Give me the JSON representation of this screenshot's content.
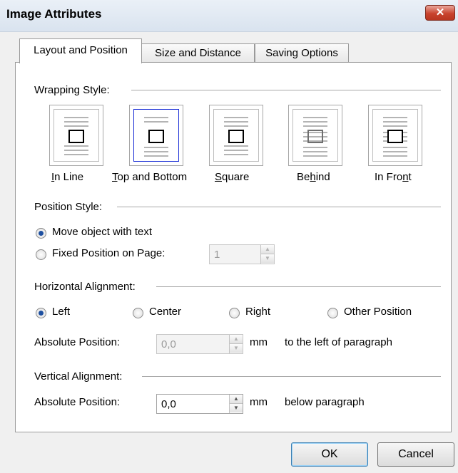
{
  "window": {
    "title": "Image Attributes",
    "close_glyph": "✕"
  },
  "tabs": [
    {
      "label": "Layout and Position",
      "active": true
    },
    {
      "label": "Size and Distance",
      "active": false
    },
    {
      "label": "Saving Options",
      "active": false
    }
  ],
  "wrapping": {
    "section_label": "Wrapping Style:",
    "options": [
      {
        "label": "In Line",
        "underline_index": 0,
        "selected": false,
        "icon": "wrap-inline-icon"
      },
      {
        "label": "Top and Bottom",
        "underline_index": 0,
        "selected": true,
        "icon": "wrap-top-bottom-icon"
      },
      {
        "label": "Square",
        "underline_index": 0,
        "selected": false,
        "icon": "wrap-square-icon"
      },
      {
        "label": "Behind",
        "underline_index": 2,
        "selected": false,
        "icon": "wrap-behind-icon"
      },
      {
        "label": "In Front",
        "underline_index": 6,
        "selected": false,
        "icon": "wrap-in-front-icon"
      }
    ]
  },
  "position": {
    "section_label": "Position Style:",
    "move_label": "Move object with text",
    "fixed_label": "Fixed Position on Page:",
    "page_value": "1",
    "selected": "move"
  },
  "horizontal": {
    "section_label": "Horizontal Alignment:",
    "options": [
      "Left",
      "Center",
      "Right",
      "Other Position"
    ],
    "selected": "Left",
    "abs_label": "Absolute Position:",
    "abs_value": "0,0",
    "unit": "mm",
    "suffix": "to the left of paragraph"
  },
  "vertical": {
    "section_label": "Vertical Alignment:",
    "abs_label": "Absolute Position:",
    "abs_value": "0,0",
    "unit": "mm",
    "suffix": "below paragraph"
  },
  "buttons": {
    "ok": "OK",
    "cancel": "Cancel"
  },
  "colors": {
    "selection_border": "#1b2fd6",
    "radio_dot": "#1d4fa0",
    "close_button": "#c9432e"
  }
}
